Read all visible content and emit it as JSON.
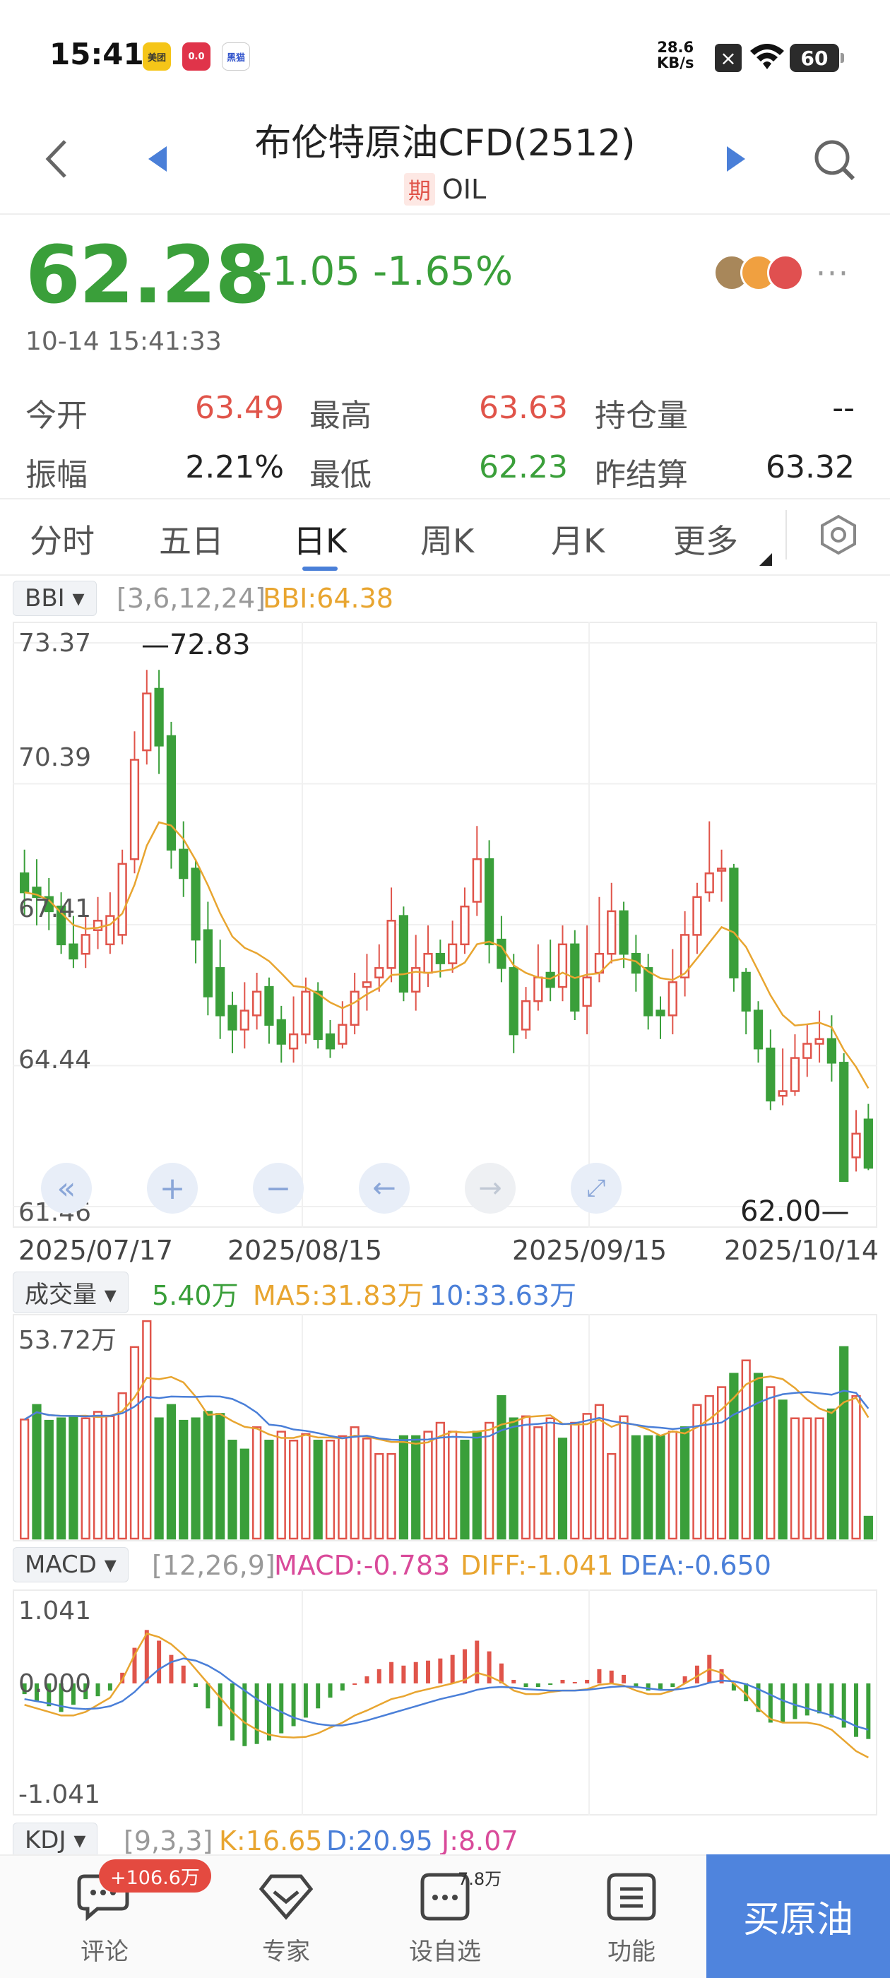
{
  "status": {
    "time": "15:41",
    "apps": [
      "美团",
      "0.0",
      "黑猫"
    ],
    "net_speed": "28.6",
    "net_unit": "KB/s",
    "battery": "60"
  },
  "header": {
    "title": "布伦特原油CFD(2512)",
    "tag": "期",
    "code": "OIL"
  },
  "quote": {
    "price": "62.28",
    "change": "-1.05",
    "change_pct": "-1.65%",
    "time": "10-14 15:41:33",
    "more": "···",
    "stats": [
      {
        "label": "今开",
        "value": "63.49"
      },
      {
        "label": "最高",
        "value": "63.63"
      },
      {
        "label": "持仓量",
        "value": "--"
      },
      {
        "label": "振幅",
        "value": "2.21%"
      },
      {
        "label": "最低",
        "value": "62.23"
      },
      {
        "label": "昨结算",
        "value": "63.32"
      }
    ]
  },
  "tabs": [
    "分时",
    "五日",
    "日K",
    "周K",
    "月K",
    "更多"
  ],
  "active_tab": "日K",
  "colors": {
    "up": "#e0544a",
    "down": "#3a9f3a",
    "ma_orange": "#e8a530",
    "ma_blue": "#4a7fd8",
    "macd_pink": "#d94a9a",
    "accent": "#4f84dd"
  },
  "kline": {
    "indicator": "BBI",
    "params": "[3,6,12,24]",
    "value_label": "BBI:64.38",
    "y_labels": [
      "73.37",
      "70.39",
      "67.41",
      "64.44",
      "61.46"
    ],
    "high_marker": "72.83",
    "low_marker": "62.00",
    "dates": [
      "2025/07/17",
      "2025/08/15",
      "2025/09/15",
      "2025/10/14"
    ],
    "controls": [
      "fast-back-icon",
      "zoom-in-icon",
      "zoom-out-icon",
      "left-arrow-icon",
      "right-arrow-icon",
      "fullscreen-icon"
    ]
  },
  "volume": {
    "indicator": "成交量",
    "val": "5.40万",
    "ma5": "MA5:31.83万",
    "ma10": "10:33.63万",
    "y_label": "53.72万"
  },
  "macd": {
    "indicator": "MACD",
    "params": "[12,26,9]",
    "macd": "MACD:-0.783",
    "diff": "DIFF:-1.041",
    "dea": "DEA:-0.650",
    "y_labels": [
      "1.041",
      "0.000",
      "-1.041"
    ]
  },
  "kdj": {
    "indicator": "KDJ",
    "params": "[9,3,3]",
    "k": "K:16.65",
    "d": "D:20.95",
    "j": "J:8.07"
  },
  "chart_data": {
    "type": "candlestick",
    "ylim": [
      61.46,
      73.37
    ],
    "x_labels": [
      "2025/07/17",
      "2025/08/15",
      "2025/09/15",
      "2025/10/14"
    ],
    "candles": [
      [
        68.5,
        68.1,
        69.0,
        67.6
      ],
      [
        68.2,
        68.0,
        68.8,
        67.4
      ],
      [
        68.0,
        67.7,
        68.4,
        67.3
      ],
      [
        67.8,
        67.0,
        68.1,
        66.8
      ],
      [
        67.0,
        66.7,
        67.6,
        66.5
      ],
      [
        66.8,
        67.2,
        67.6,
        66.5
      ],
      [
        67.3,
        67.5,
        68.0,
        66.9
      ],
      [
        67.0,
        67.6,
        68.1,
        66.8
      ],
      [
        67.2,
        68.7,
        69.0,
        67.0
      ],
      [
        68.8,
        70.9,
        71.5,
        68.5
      ],
      [
        71.1,
        72.3,
        72.8,
        70.8
      ],
      [
        72.4,
        71.2,
        72.8,
        70.6
      ],
      [
        71.4,
        69.0,
        71.7,
        68.6
      ],
      [
        69.0,
        68.4,
        69.6,
        68.0
      ],
      [
        68.6,
        67.1,
        68.8,
        66.6
      ],
      [
        67.3,
        65.9,
        67.9,
        65.5
      ],
      [
        66.5,
        65.5,
        67.1,
        65.0
      ],
      [
        65.7,
        65.2,
        66.0,
        64.7
      ],
      [
        65.2,
        65.6,
        66.2,
        64.8
      ],
      [
        65.5,
        66.0,
        66.4,
        65.2
      ],
      [
        66.1,
        65.3,
        66.3,
        64.9
      ],
      [
        65.4,
        64.9,
        65.7,
        64.5
      ],
      [
        64.8,
        65.1,
        65.9,
        64.5
      ],
      [
        65.1,
        66.0,
        66.3,
        64.9
      ],
      [
        66.0,
        65.0,
        66.2,
        64.8
      ],
      [
        65.1,
        64.8,
        65.4,
        64.6
      ],
      [
        64.9,
        65.3,
        65.8,
        64.8
      ],
      [
        65.3,
        66.0,
        66.4,
        65.1
      ],
      [
        66.1,
        66.2,
        66.8,
        65.6
      ],
      [
        66.3,
        66.5,
        67.0,
        66.0
      ],
      [
        66.5,
        67.5,
        68.2,
        66.2
      ],
      [
        67.6,
        66.0,
        67.8,
        65.8
      ],
      [
        66.0,
        66.5,
        67.2,
        65.6
      ],
      [
        66.4,
        66.8,
        67.4,
        66.1
      ],
      [
        66.8,
        66.6,
        67.1,
        66.3
      ],
      [
        66.6,
        67.0,
        67.5,
        66.4
      ],
      [
        67.0,
        67.8,
        68.2,
        66.8
      ],
      [
        67.9,
        68.8,
        69.5,
        67.6
      ],
      [
        68.8,
        67.0,
        69.2,
        66.6
      ],
      [
        67.1,
        66.5,
        67.6,
        66.2
      ],
      [
        66.5,
        65.1,
        66.8,
        64.7
      ],
      [
        65.2,
        65.8,
        66.1,
        65.0
      ],
      [
        65.8,
        66.3,
        67.0,
        65.6
      ],
      [
        66.4,
        66.1,
        67.1,
        65.8
      ],
      [
        66.1,
        67.0,
        67.4,
        65.8
      ],
      [
        67.0,
        65.6,
        67.3,
        65.4
      ],
      [
        65.7,
        66.3,
        67.4,
        65.1
      ],
      [
        66.4,
        66.8,
        68.0,
        66.2
      ],
      [
        66.8,
        67.7,
        68.3,
        66.6
      ],
      [
        67.7,
        66.8,
        67.9,
        66.5
      ],
      [
        66.8,
        66.4,
        67.2,
        66.0
      ],
      [
        66.5,
        65.5,
        66.8,
        65.2
      ],
      [
        65.6,
        65.5,
        65.9,
        65.0
      ],
      [
        65.5,
        66.2,
        66.9,
        65.1
      ],
      [
        66.3,
        67.2,
        67.7,
        65.9
      ],
      [
        67.2,
        68.0,
        68.3,
        66.8
      ],
      [
        68.1,
        68.5,
        69.6,
        67.9
      ],
      [
        68.6,
        68.6,
        69.0,
        67.9
      ],
      [
        68.6,
        66.3,
        68.7,
        66.0
      ],
      [
        66.4,
        65.6,
        66.5,
        65.1
      ],
      [
        65.6,
        64.8,
        65.8,
        64.5
      ],
      [
        64.8,
        63.7,
        65.2,
        63.5
      ],
      [
        63.8,
        63.9,
        64.8,
        63.6
      ],
      [
        63.9,
        64.6,
        65.1,
        63.8
      ],
      [
        64.6,
        64.9,
        65.3,
        64.2
      ],
      [
        64.9,
        65.0,
        65.6,
        64.5
      ],
      [
        65.0,
        64.5,
        65.5,
        64.1
      ],
      [
        64.5,
        62.0,
        64.7,
        62.0
      ],
      [
        62.5,
        63.0,
        63.5,
        62.2
      ],
      [
        63.3,
        62.28,
        63.63,
        62.23
      ]
    ],
    "volumes": [
      [
        29.4,
        1
      ],
      [
        33.0,
        0
      ],
      [
        29.1,
        0
      ],
      [
        29.7,
        0
      ],
      [
        30.2,
        0
      ],
      [
        29.7,
        1
      ],
      [
        31.3,
        1
      ],
      [
        30.2,
        1
      ],
      [
        35.9,
        1
      ],
      [
        47.3,
        1
      ],
      [
        53.7,
        1
      ],
      [
        29.7,
        0
      ],
      [
        33.0,
        0
      ],
      [
        29.1,
        0
      ],
      [
        29.7,
        0
      ],
      [
        31.3,
        0
      ],
      [
        30.8,
        0
      ],
      [
        24.2,
        0
      ],
      [
        22.0,
        0
      ],
      [
        27.5,
        1
      ],
      [
        24.2,
        0
      ],
      [
        26.4,
        1
      ],
      [
        24.2,
        1
      ],
      [
        25.8,
        1
      ],
      [
        24.2,
        0
      ],
      [
        24.2,
        1
      ],
      [
        25.3,
        1
      ],
      [
        27.5,
        1
      ],
      [
        24.7,
        1
      ],
      [
        20.9,
        1
      ],
      [
        20.9,
        1
      ],
      [
        25.3,
        0
      ],
      [
        25.3,
        0
      ],
      [
        26.4,
        1
      ],
      [
        28.6,
        1
      ],
      [
        26.4,
        1
      ],
      [
        24.2,
        0
      ],
      [
        26.4,
        0
      ],
      [
        28.6,
        1
      ],
      [
        35.2,
        0
      ],
      [
        29.7,
        0
      ],
      [
        30.2,
        1
      ],
      [
        27.5,
        1
      ],
      [
        29.7,
        1
      ],
      [
        24.7,
        0
      ],
      [
        28.6,
        1
      ],
      [
        30.8,
        1
      ],
      [
        33.0,
        1
      ],
      [
        20.9,
        1
      ],
      [
        30.2,
        1
      ],
      [
        25.3,
        0
      ],
      [
        25.3,
        0
      ],
      [
        25.3,
        0
      ],
      [
        26.4,
        1
      ],
      [
        27.5,
        0
      ],
      [
        33.0,
        1
      ],
      [
        35.2,
        1
      ],
      [
        37.4,
        1
      ],
      [
        40.7,
        0
      ],
      [
        44.0,
        1
      ],
      [
        40.7,
        0
      ],
      [
        37.4,
        1
      ],
      [
        34.1,
        0
      ],
      [
        29.7,
        1
      ],
      [
        29.7,
        1
      ],
      [
        29.7,
        1
      ],
      [
        31.9,
        0
      ],
      [
        47.3,
        0
      ],
      [
        35.2,
        1
      ],
      [
        5.4,
        0
      ]
    ],
    "macd_hist": [
      -0.15,
      -0.25,
      -0.32,
      -0.4,
      -0.3,
      -0.22,
      -0.18,
      -0.1,
      0.15,
      0.5,
      0.75,
      0.6,
      0.4,
      0.25,
      -0.05,
      -0.35,
      -0.6,
      -0.8,
      -0.88,
      -0.85,
      -0.8,
      -0.7,
      -0.6,
      -0.48,
      -0.35,
      -0.2,
      -0.1,
      0.0,
      0.1,
      0.2,
      0.3,
      0.25,
      0.3,
      0.32,
      0.35,
      0.4,
      0.48,
      0.6,
      0.45,
      0.28,
      0.05,
      -0.05,
      -0.05,
      -0.02,
      0.05,
      0.02,
      0.05,
      0.2,
      0.18,
      0.12,
      -0.05,
      -0.1,
      -0.1,
      -0.05,
      0.1,
      0.25,
      0.4,
      0.2,
      -0.1,
      -0.25,
      -0.4,
      -0.55,
      -0.55,
      -0.5,
      -0.45,
      -0.42,
      -0.48,
      -0.62,
      -0.75,
      -0.78
    ],
    "macd_diff": [
      -0.3,
      -0.35,
      -0.4,
      -0.45,
      -0.45,
      -0.4,
      -0.3,
      -0.2,
      0.05,
      0.4,
      0.7,
      0.65,
      0.55,
      0.4,
      0.2,
      0.0,
      -0.2,
      -0.4,
      -0.55,
      -0.65,
      -0.72,
      -0.75,
      -0.76,
      -0.75,
      -0.7,
      -0.62,
      -0.55,
      -0.45,
      -0.38,
      -0.3,
      -0.22,
      -0.18,
      -0.12,
      -0.08,
      -0.04,
      0.0,
      0.05,
      0.15,
      0.1,
      0.02,
      -0.1,
      -0.15,
      -0.15,
      -0.12,
      -0.1,
      -0.1,
      -0.08,
      -0.02,
      0.0,
      -0.03,
      -0.1,
      -0.15,
      -0.15,
      -0.1,
      0.0,
      0.1,
      0.2,
      0.15,
      0.0,
      -0.15,
      -0.35,
      -0.5,
      -0.55,
      -0.55,
      -0.55,
      -0.58,
      -0.65,
      -0.8,
      -0.95,
      -1.04
    ],
    "macd_dea": [
      -0.22,
      -0.25,
      -0.28,
      -0.32,
      -0.35,
      -0.36,
      -0.35,
      -0.32,
      -0.25,
      -0.12,
      0.05,
      0.2,
      0.3,
      0.35,
      0.32,
      0.25,
      0.15,
      0.02,
      -0.1,
      -0.22,
      -0.32,
      -0.4,
      -0.48,
      -0.53,
      -0.57,
      -0.59,
      -0.59,
      -0.56,
      -0.52,
      -0.47,
      -0.42,
      -0.37,
      -0.32,
      -0.27,
      -0.22,
      -0.18,
      -0.14,
      -0.09,
      -0.06,
      -0.05,
      -0.06,
      -0.08,
      -0.09,
      -0.1,
      -0.1,
      -0.1,
      -0.09,
      -0.07,
      -0.05,
      -0.04,
      -0.05,
      -0.07,
      -0.09,
      -0.09,
      -0.07,
      -0.04,
      0.01,
      0.04,
      0.03,
      -0.01,
      -0.08,
      -0.16,
      -0.24,
      -0.3,
      -0.35,
      -0.4,
      -0.45,
      -0.52,
      -0.6,
      -0.65
    ]
  },
  "bottom_nav": {
    "comment_badge": "+106.6万",
    "watchlist_badge": "7.8万",
    "items": [
      "评论",
      "专家",
      "设自选",
      "功能"
    ],
    "buy_label": "买原油"
  }
}
